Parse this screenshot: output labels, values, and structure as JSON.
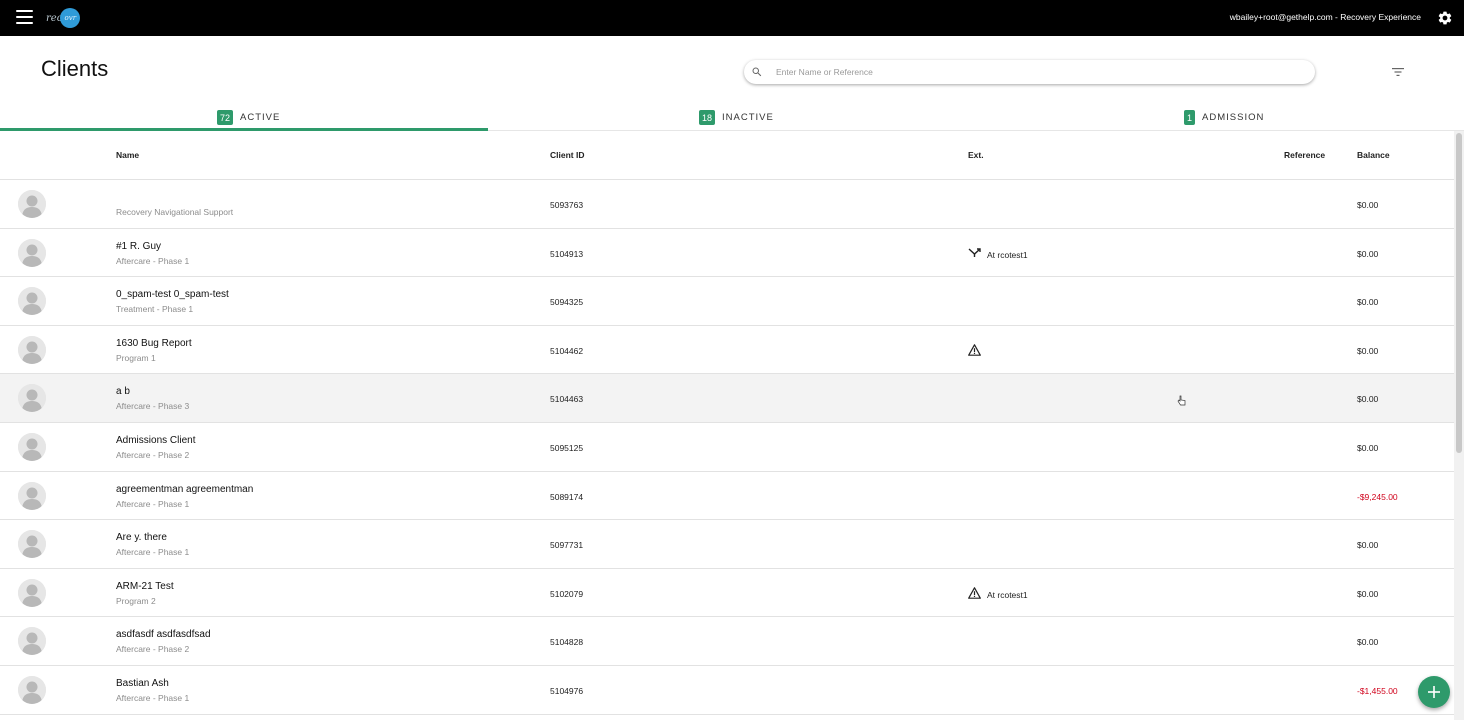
{
  "topbar": {
    "logo_prefix": "rec",
    "logo_suffix": "ovr",
    "user_text": "wbailey+root@gethelp.com - Recovery Experience"
  },
  "header": {
    "title": "Clients",
    "search_placeholder": "Enter Name or Reference"
  },
  "tabs": [
    {
      "count": "72",
      "label": "ACTIVE"
    },
    {
      "count": "18",
      "label": "INACTIVE"
    },
    {
      "count": "1",
      "label": "ADMISSION"
    }
  ],
  "columns": {
    "name": "Name",
    "client_id": "Client ID",
    "ext": "Ext.",
    "reference": "Reference",
    "balance": "Balance"
  },
  "rows": [
    {
      "name": "",
      "sub": "Recovery Navigational Support",
      "id": "5093763",
      "ext_icon": "",
      "ext_text": "",
      "balance": "$0.00"
    },
    {
      "name": "#1 R. Guy",
      "sub": "Aftercare - Phase 1",
      "id": "5104913",
      "ext_icon": "transfer-icon",
      "ext_text": "At rcotest1",
      "balance": "$0.00"
    },
    {
      "name": "0_spam-test 0_spam-test",
      "sub": "Treatment - Phase 1",
      "id": "5094325",
      "ext_icon": "",
      "ext_text": "",
      "balance": "$0.00"
    },
    {
      "name": "1630 Bug Report",
      "sub": "Program 1",
      "id": "5104462",
      "ext_icon": "warning-icon",
      "ext_text": "",
      "balance": "$0.00"
    },
    {
      "name": "a b",
      "sub": "Aftercare - Phase 3",
      "id": "5104463",
      "ext_icon": "",
      "ext_text": "",
      "balance": "$0.00"
    },
    {
      "name": "Admissions Client",
      "sub": "Aftercare - Phase 2",
      "id": "5095125",
      "ext_icon": "",
      "ext_text": "",
      "balance": "$0.00"
    },
    {
      "name": "agreementman agreementman",
      "sub": "Aftercare - Phase 1",
      "id": "5089174",
      "ext_icon": "",
      "ext_text": "",
      "balance": "-$9,245.00"
    },
    {
      "name": "Are y. there",
      "sub": "Aftercare - Phase 1",
      "id": "5097731",
      "ext_icon": "",
      "ext_text": "",
      "balance": "$0.00"
    },
    {
      "name": "ARM-21 Test",
      "sub": "Program 2",
      "id": "5102079",
      "ext_icon": "warning-icon",
      "ext_text": "At rcotest1",
      "balance": "$0.00"
    },
    {
      "name": "asdfasdf asdfasdfsad",
      "sub": "Aftercare - Phase 2",
      "id": "5104828",
      "ext_icon": "",
      "ext_text": "",
      "balance": "$0.00"
    },
    {
      "name": "Bastian Ash",
      "sub": "Aftercare - Phase 1",
      "id": "5104976",
      "ext_icon": "",
      "ext_text": "",
      "balance": "-$1,455.00"
    }
  ],
  "colors": {
    "accent": "#2e9a6b",
    "negative": "#d0021b",
    "topbar": "#000000"
  }
}
